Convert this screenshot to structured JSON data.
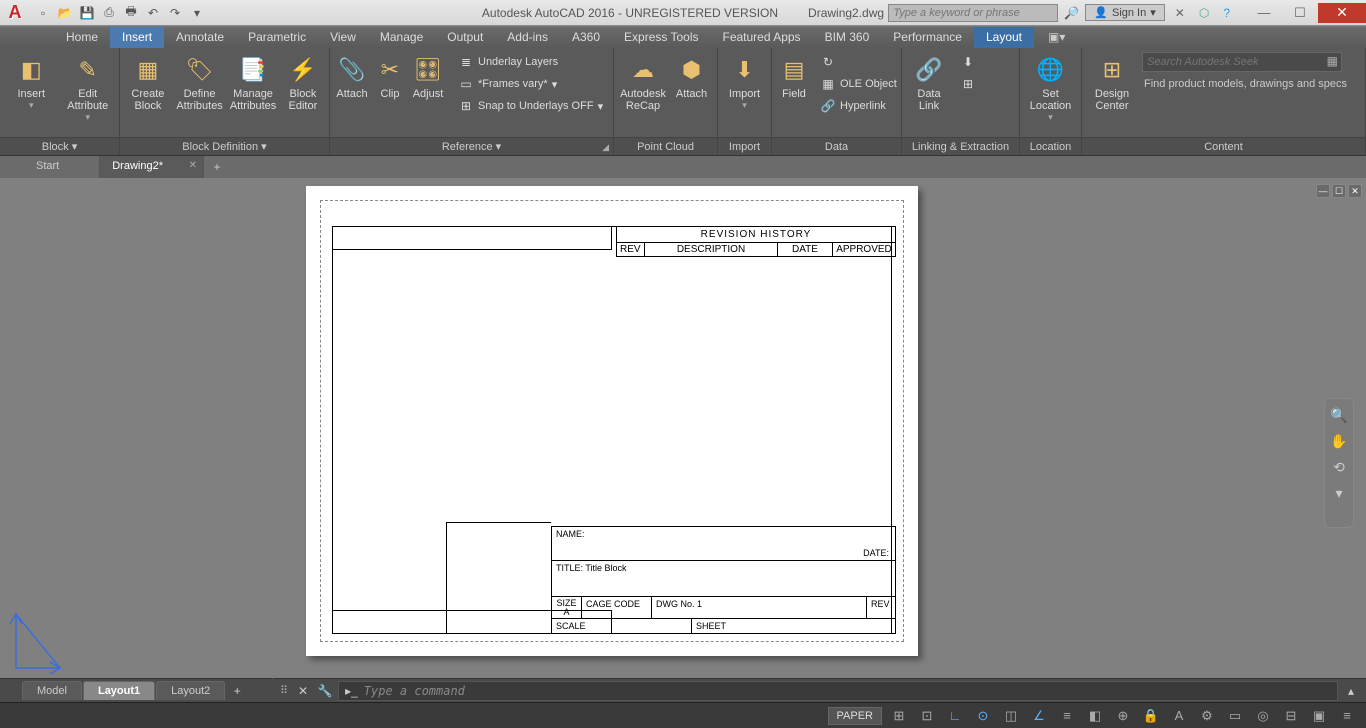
{
  "title": {
    "app": "Autodesk AutoCAD 2016 - UNREGISTERED VERSION",
    "file": "Drawing2.dwg"
  },
  "search_placeholder": "Type a keyword or phrase",
  "signin": "Sign In",
  "tabs": [
    "Home",
    "Insert",
    "Annotate",
    "Parametric",
    "View",
    "Manage",
    "Output",
    "Add-ins",
    "A360",
    "Express Tools",
    "Featured Apps",
    "BIM 360",
    "Performance",
    "Layout"
  ],
  "active_tab": "Layout",
  "highlighted_tab": "Insert",
  "ribbon": {
    "block": {
      "title": "Block",
      "insert": "Insert",
      "edit_attr": "Edit\nAttribute"
    },
    "blockdef": {
      "title": "Block Definition",
      "create": "Create\nBlock",
      "define": "Define\nAttributes",
      "manage": "Manage\nAttributes",
      "editor": "Block\nEditor"
    },
    "reference": {
      "title": "Reference",
      "attach": "Attach",
      "clip": "Clip",
      "adjust": "Adjust",
      "underlay": "Underlay Layers",
      "frames": "*Frames vary*",
      "snap": "Snap to Underlays OFF"
    },
    "pointcloud": {
      "title": "Point Cloud",
      "recap": "Autodesk\nReCap",
      "attach": "Attach"
    },
    "import": {
      "title": "Import",
      "import": "Import"
    },
    "data": {
      "title": "Data",
      "field": "Field",
      "ole": "OLE Object",
      "hyperlink": "Hyperlink"
    },
    "linking": {
      "title": "Linking & Extraction",
      "datalink": "Data\nLink"
    },
    "location": {
      "title": "Location",
      "set": "Set\nLocation"
    },
    "content": {
      "title": "Content",
      "design": "Design\nCenter",
      "seek_ph": "Search Autodesk Seek",
      "seek_txt": "Find product models, drawings and specs"
    }
  },
  "filetabs": {
    "start": "Start",
    "d2": "Drawing2*"
  },
  "sheet": {
    "rev_title": "REVISION  HISTORY",
    "rev_cols": {
      "rev": "REV",
      "desc": "DESCRIPTION",
      "date": "DATE",
      "appr": "APPROVED"
    },
    "name": "NAME:",
    "date": "DATE:",
    "title_lbl": "TITLE:",
    "title_val": "Title Block",
    "size_lbl": "SIZE",
    "size_val": "A",
    "cage": "CAGE  CODE",
    "dwg": "DWG  No.  1",
    "rev": "REV",
    "scale": "SCALE",
    "sheet_lbl": "SHEET"
  },
  "cmd_prompt": "Type a command",
  "bottom": {
    "model": "Model",
    "l1": "Layout1",
    "l2": "Layout2"
  },
  "paper_label": "PAPER"
}
